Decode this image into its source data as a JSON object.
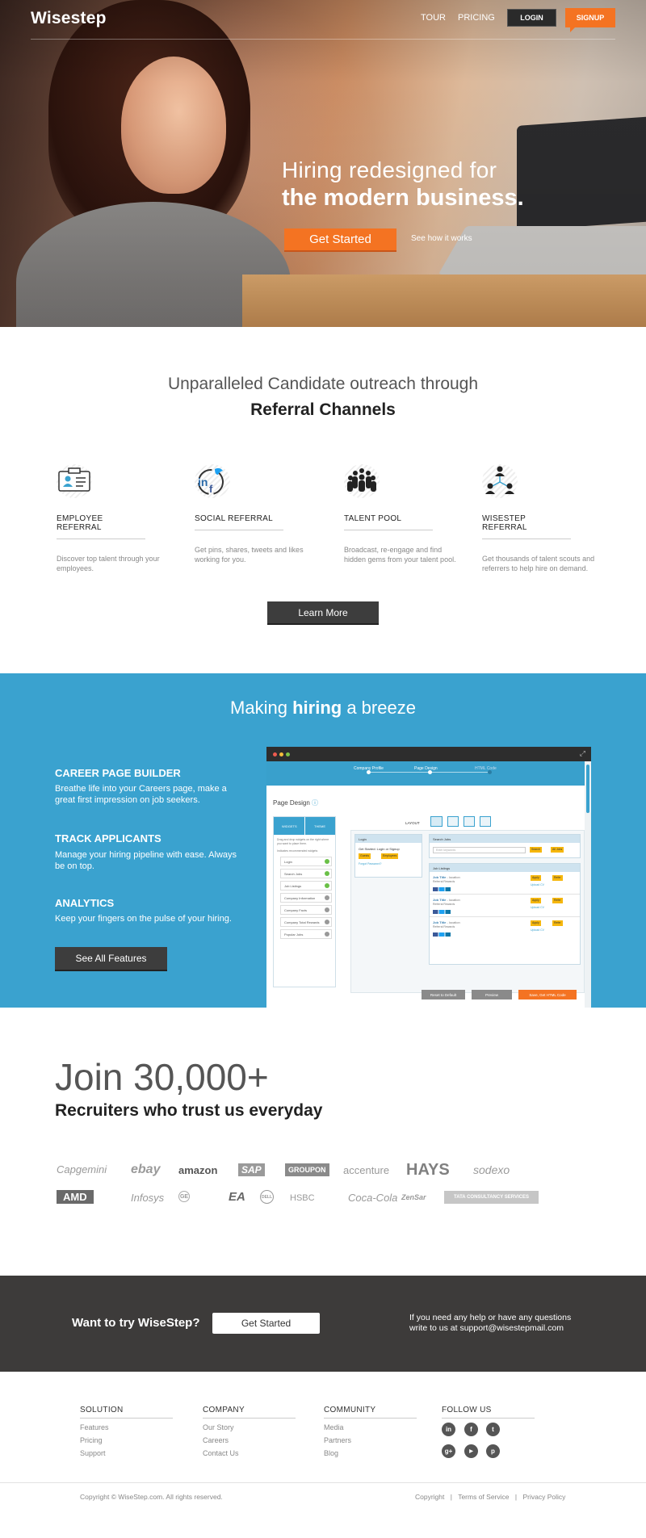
{
  "nav": {
    "logo": "Wisestep",
    "tour": "TOUR",
    "pricing": "PRICING",
    "login": "LOGIN",
    "signup": "SIGNUP"
  },
  "hero": {
    "line1": "Hiring redesigned for",
    "line2": "the modern business.",
    "cta": "Get Started",
    "secondary": "See how it works"
  },
  "referral": {
    "heading1": "Unparalleled Candidate outreach through",
    "heading2": "Referral Channels",
    "features": [
      {
        "icon": "id-card-icon",
        "title": "EMPLOYEE REFERRAL",
        "desc": "Discover top talent through your employees."
      },
      {
        "icon": "social-network-icon",
        "title": "SOCIAL REFERRAL",
        "desc": "Get  pins, shares, tweets and likes working for you."
      },
      {
        "icon": "crowd-icon",
        "title": "TALENT POOL",
        "desc": "Broadcast, re-engage and find hidden gems from your talent pool."
      },
      {
        "icon": "people-network-icon",
        "title": "WISESTEP REFERRAL",
        "desc": "Get thousands of talent scouts and referrers to help hire on demand."
      }
    ],
    "cta": "Learn More"
  },
  "breeze": {
    "pre": "Making ",
    "bold": "hiring",
    "post": " a breeze",
    "items": [
      {
        "title": "CAREER PAGE BUILDER",
        "desc": "Breathe life into your Careers page, make a great first  impression on job seekers."
      },
      {
        "title": "TRACK APPLICANTS",
        "desc": "Manage your hiring pipeline with ease. Always be on top."
      },
      {
        "title": "ANALYTICS",
        "desc": "Keep your fingers on the pulse of your hiring."
      }
    ],
    "cta": "See All Features"
  },
  "app": {
    "steps": [
      "Company Profile",
      "Page Design",
      "HTML Code"
    ],
    "page_title": "Page Design",
    "tabs": [
      "WIDGETS",
      "THEME"
    ],
    "hint": "Drag and drop widgets on the right where you want to place them.",
    "recommended": "Indicates recommended widgets",
    "layout": "LAYOUT",
    "widgets": [
      "Login",
      "Search Jobs",
      "Job Listings",
      "Company Information",
      "Company Facts",
      "Company Total Rewards",
      "Popular Jobs"
    ],
    "login_box": {
      "title": "Login",
      "text": "Get Started: Login or Signup",
      "b1": "Guests",
      "b2": "Employees",
      "link": "Forgot Password?"
    },
    "search_box": {
      "title": "Search Jobs",
      "placeholder": "Enter keywords",
      "b1": "Search",
      "b2": "All Jobs"
    },
    "listings": {
      "title": "Job Listings",
      "job": "Job Title",
      "loc": "- location",
      "reward": "Referral Rewards",
      "apply": "Apply",
      "refer": "Refer",
      "upload": "Upload CV"
    },
    "buttons": [
      "Reset to Default",
      "Preview",
      "Save, Get HTML Code"
    ]
  },
  "join": {
    "big": "Join 30,000+",
    "sub": "Recruiters who trust  us everyday",
    "brands_row1": [
      "Capgemini",
      "ebay",
      "amazon",
      "SAP",
      "GROUPON",
      "accenture",
      "HAYS",
      "sodexo"
    ],
    "brands_row2": [
      "AMD",
      "Infosys",
      "GE",
      "EA",
      "DELL",
      "HSBC",
      "Coca-Cola",
      "ZenSar",
      "TATA CONSULTANCY SERVICES"
    ]
  },
  "cta": {
    "text": "Want to try WiseStep?",
    "button": "Get Started",
    "help1": "If you need any help or have any questions",
    "help2": "write to us at support@wisestepmail.com"
  },
  "footer": {
    "solution": {
      "title": "SOLUTION",
      "links": [
        "Features",
        "Pricing",
        "Support"
      ]
    },
    "company": {
      "title": "COMPANY",
      "links": [
        "Our Story",
        "Careers",
        "Contact Us"
      ]
    },
    "community": {
      "title": "COMMUNITY",
      "links": [
        "Media",
        "Partners",
        "Blog"
      ]
    },
    "follow": {
      "title": "FOLLOW US",
      "icons": [
        "linkedin-icon",
        "facebook-icon",
        "twitter-icon",
        "google-plus-icon",
        "youtube-icon",
        "pinterest-icon"
      ]
    },
    "copyright": "Copyright © WiseStep.com. All rights reserved.",
    "legal": [
      "Copyright",
      "Terms of Service",
      "Privacy Policy"
    ]
  }
}
